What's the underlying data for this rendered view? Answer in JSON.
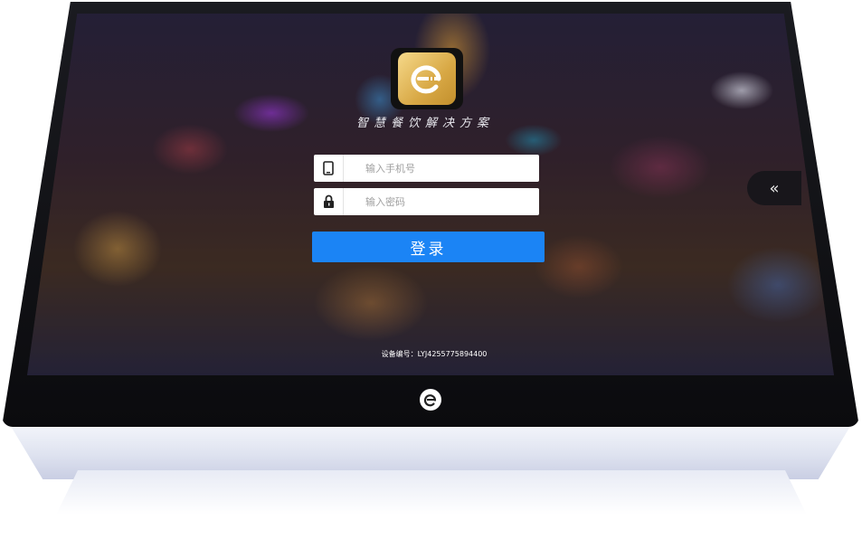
{
  "app": {
    "slogan": "智慧餐饮解决方案",
    "logo_icon": "restaurant-e-logo-icon"
  },
  "login": {
    "phone_placeholder": "输入手机号",
    "password_placeholder": "输入密码",
    "phone_icon": "phone-icon",
    "password_icon": "lock-icon",
    "submit_label": "登录"
  },
  "footer": {
    "device_id": "设备编号：LYJ4255775894400"
  },
  "side_tab": {
    "label": "«",
    "icon": "double-chevron-left-icon"
  },
  "hardware": {
    "home_icon": "home-e-icon"
  },
  "colors": {
    "accent": "#1b84f5",
    "logo_gold": "#d8a845"
  }
}
